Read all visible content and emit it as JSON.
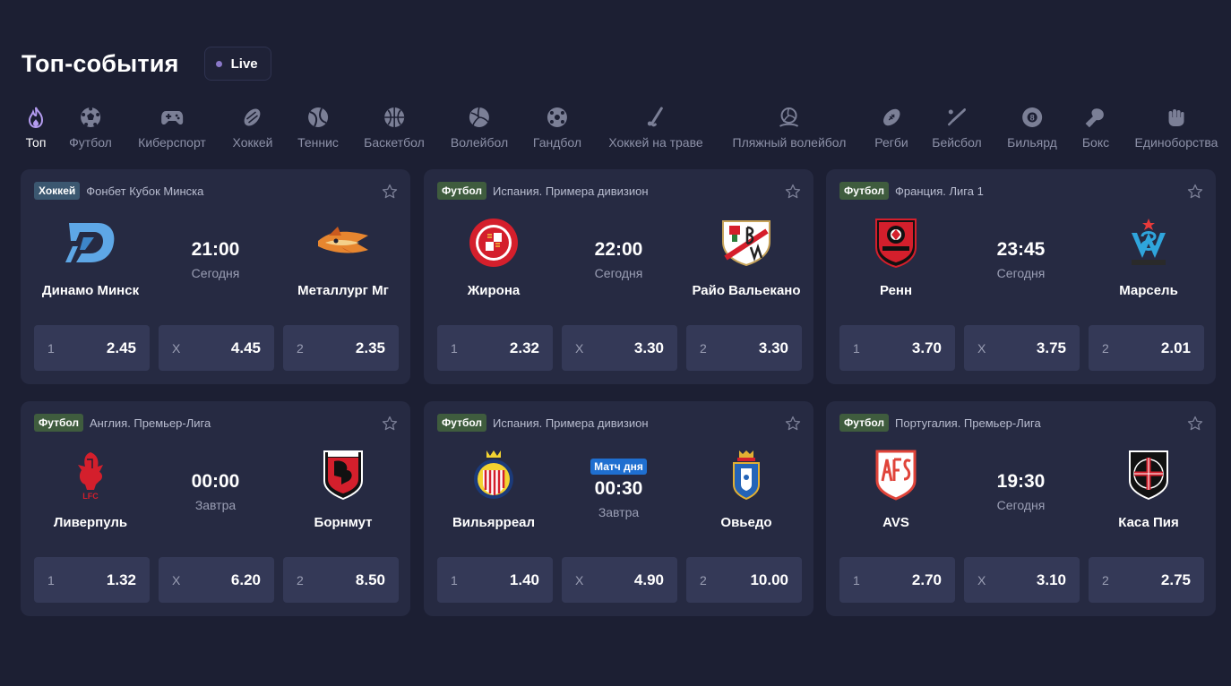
{
  "header": {
    "title": "Топ-события",
    "live_label": "Live"
  },
  "sports": [
    {
      "label": "Топ",
      "icon": "flame-icon",
      "active": true
    },
    {
      "label": "Футбол",
      "icon": "soccer-ball-icon"
    },
    {
      "label": "Киберспорт",
      "icon": "gamepad-icon"
    },
    {
      "label": "Хоккей",
      "icon": "hockey-puck-icon"
    },
    {
      "label": "Теннис",
      "icon": "tennis-ball-icon"
    },
    {
      "label": "Баскетбол",
      "icon": "basketball-icon"
    },
    {
      "label": "Волейбол",
      "icon": "volleyball-icon"
    },
    {
      "label": "Гандбол",
      "icon": "handball-icon"
    },
    {
      "label": "Хоккей на траве",
      "icon": "field-hockey-icon"
    },
    {
      "label": "Пляжный волейбол",
      "icon": "beach-volleyball-icon"
    },
    {
      "label": "Регби",
      "icon": "rugby-ball-icon"
    },
    {
      "label": "Бейсбол",
      "icon": "baseball-bat-icon"
    },
    {
      "label": "Бильярд",
      "icon": "billiard-ball-icon"
    },
    {
      "label": "Бокс",
      "icon": "boxing-glove-icon"
    },
    {
      "label": "Единоборства",
      "icon": "fist-icon"
    }
  ],
  "colors": {
    "background": "#1c1f33",
    "card": "#262a42",
    "odd_button": "#343957",
    "football_badge": "#3f5c3e",
    "hockey_badge": "#3b5770",
    "match_of_day": "#1f6fd0"
  },
  "events": [
    {
      "sport": "Хоккей",
      "league": "Фонбет Кубок Минска",
      "home": "Динамо Минск",
      "away": "Металлург Мг",
      "home_logo": "dinamo-minsk-logo",
      "away_logo": "metallurg-logo",
      "time": "21:00",
      "day": "Сегодня",
      "odds": [
        {
          "k": "1",
          "v": "2.45"
        },
        {
          "k": "X",
          "v": "4.45"
        },
        {
          "k": "2",
          "v": "2.35"
        }
      ]
    },
    {
      "sport": "Футбол",
      "league": "Испания. Примера дивизион",
      "home": "Жирона",
      "away": "Райо Вальекано",
      "home_logo": "girona-logo",
      "away_logo": "rayo-logo",
      "time": "22:00",
      "day": "Сегодня",
      "odds": [
        {
          "k": "1",
          "v": "2.32"
        },
        {
          "k": "X",
          "v": "3.30"
        },
        {
          "k": "2",
          "v": "3.30"
        }
      ]
    },
    {
      "sport": "Футбол",
      "league": "Франция. Лига 1",
      "home": "Ренн",
      "away": "Марсель",
      "home_logo": "rennes-logo",
      "away_logo": "marseille-logo",
      "time": "23:45",
      "day": "Сегодня",
      "odds": [
        {
          "k": "1",
          "v": "3.70"
        },
        {
          "k": "X",
          "v": "3.75"
        },
        {
          "k": "2",
          "v": "2.01"
        }
      ]
    },
    {
      "sport": "Футбол",
      "league": "Англия. Премьер-Лига",
      "home": "Ливерпуль",
      "away": "Борнмут",
      "home_logo": "liverpool-logo",
      "away_logo": "bournemouth-logo",
      "time": "00:00",
      "day": "Завтра",
      "odds": [
        {
          "k": "1",
          "v": "1.32"
        },
        {
          "k": "X",
          "v": "6.20"
        },
        {
          "k": "2",
          "v": "8.50"
        }
      ]
    },
    {
      "sport": "Футбол",
      "league": "Испания. Примера дивизион",
      "home": "Вильярреал",
      "away": "Овьедо",
      "home_logo": "villarreal-logo",
      "away_logo": "oviedo-logo",
      "badge": "Матч дня",
      "time": "00:30",
      "day": "Завтра",
      "odds": [
        {
          "k": "1",
          "v": "1.40"
        },
        {
          "k": "X",
          "v": "4.90"
        },
        {
          "k": "2",
          "v": "10.00"
        }
      ]
    },
    {
      "sport": "Футбол",
      "league": "Португалия. Премьер-Лига",
      "home": "AVS",
      "away": "Каса Пия",
      "home_logo": "avs-logo",
      "away_logo": "casa-pia-logo",
      "time": "19:30",
      "day": "Сегодня",
      "odds": [
        {
          "k": "1",
          "v": "2.70"
        },
        {
          "k": "X",
          "v": "3.10"
        },
        {
          "k": "2",
          "v": "2.75"
        }
      ]
    }
  ]
}
